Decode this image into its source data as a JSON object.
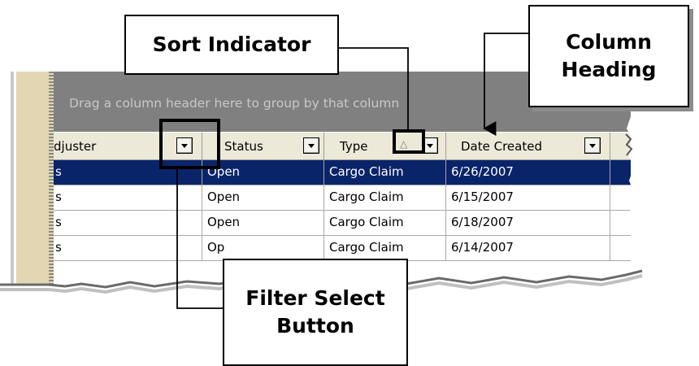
{
  "grid": {
    "group_area_text": "Drag a column header here to group by that column",
    "columns": [
      {
        "label": "djuster",
        "has_filter": true
      },
      {
        "label": "Status",
        "has_filter": true
      },
      {
        "label": "Type",
        "has_filter": true,
        "sort": "ascending"
      },
      {
        "label": "Date Created",
        "has_filter": true
      }
    ],
    "rows": [
      {
        "adjuster": "s",
        "status": "Open",
        "type": "Cargo Claim",
        "date": "6/26/2007",
        "selected": true
      },
      {
        "adjuster": "s",
        "status": "Open",
        "type": "Cargo Claim",
        "date": "6/15/2007",
        "selected": false
      },
      {
        "adjuster": "s",
        "status": "Open",
        "type": "Cargo Claim",
        "date": "6/18/2007",
        "selected": false
      },
      {
        "adjuster": "s",
        "status": "Op",
        "type": "Cargo Claim",
        "date": "6/14/2007",
        "selected": false
      }
    ],
    "colors": {
      "selected_row": "#0a246a",
      "group_area": "#808080",
      "header": "#ece9d8"
    }
  },
  "callouts": {
    "sort_indicator": "Sort Indicator",
    "column_heading_line1": "Column",
    "column_heading_line2": "Heading",
    "filter_select_line1": "Filter Select",
    "filter_select_line2": "Button"
  },
  "icons": {
    "filter": "chevron-down-icon",
    "sort": "sort-ascending-icon"
  }
}
